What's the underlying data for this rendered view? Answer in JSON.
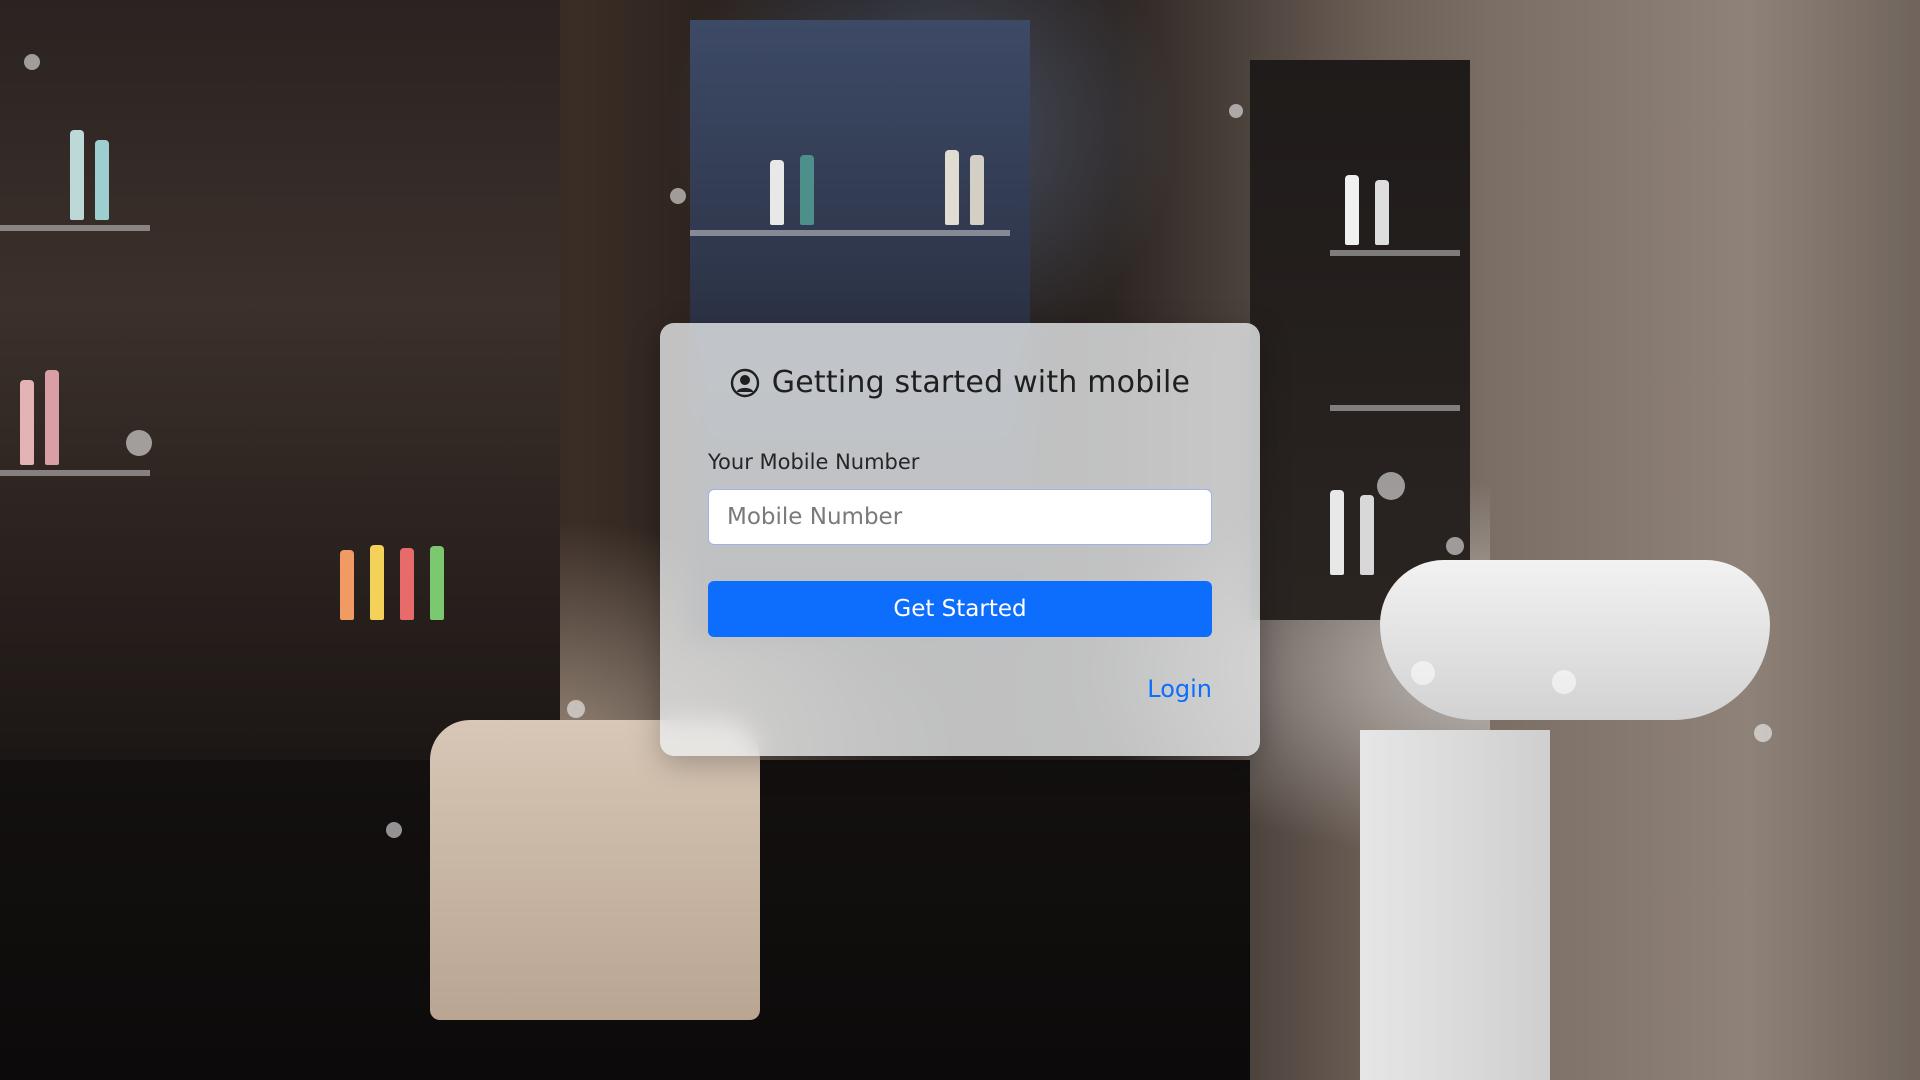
{
  "card": {
    "title": "Getting started with mobile",
    "title_icon": "user-circle-icon",
    "mobile_label": "Your Mobile Number",
    "mobile_placeholder": "Mobile Number",
    "mobile_value": "",
    "submit_label": "Get Started",
    "login_label": "Login"
  },
  "colors": {
    "primary": "#0d6efd",
    "card_background": "#eceef0",
    "input_border": "#9bb5e6"
  }
}
